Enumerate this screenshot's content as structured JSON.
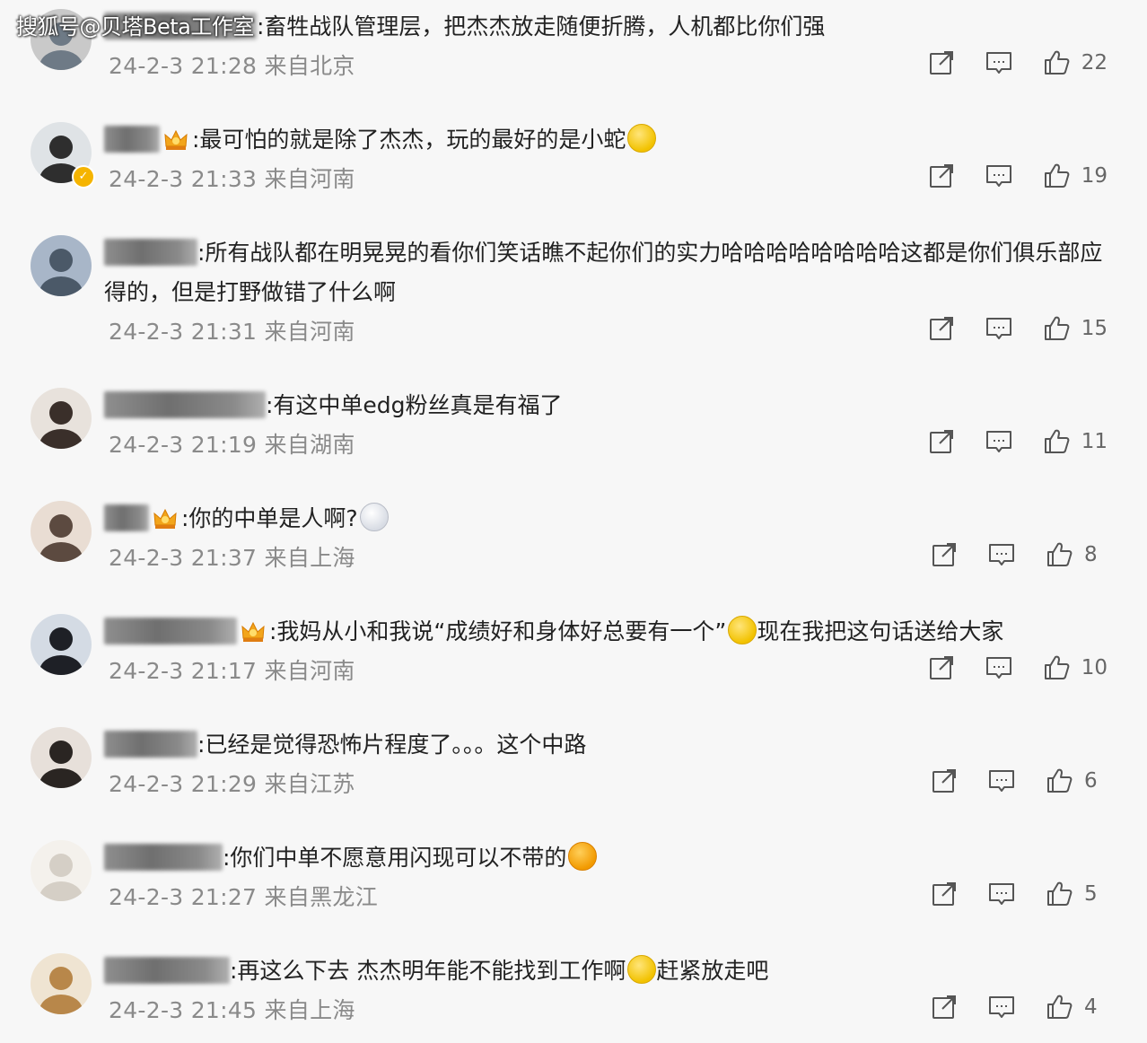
{
  "watermark": "搜狐号@贝塔Beta工作室",
  "comments": [
    {
      "text": ":畜牲战队管理层，把杰杰放走随便折腾，人机都比你们强",
      "crown": false,
      "emoji": "",
      "text2": "",
      "time": "24-2-3 21:28",
      "location": "来自北京",
      "likes": "22"
    },
    {
      "text": ":最可怕的就是除了杰杰，玩的最好的是小蛇",
      "crown": true,
      "emoji": "smile",
      "text2": "",
      "time": "24-2-3 21:33",
      "location": "来自河南",
      "likes": "19"
    },
    {
      "text": ":所有战队都在明晃晃的看你们笑话瞧不起你们的实力哈哈哈哈哈哈哈哈这都是你们俱乐部应得的，但是打野做错了什么啊",
      "crown": false,
      "emoji": "",
      "text2": "",
      "time": "24-2-3 21:31",
      "location": "来自河南",
      "likes": "15"
    },
    {
      "text": ":有这中单edg粉丝真是有福了",
      "crown": false,
      "emoji": "",
      "text2": "",
      "time": "24-2-3 21:19",
      "location": "来自湖南",
      "likes": "11"
    },
    {
      "text": ":你的中单是人啊?",
      "crown": true,
      "emoji": "egg",
      "text2": "",
      "time": "24-2-3 21:37",
      "location": "来自上海",
      "likes": "8"
    },
    {
      "text": ":我妈从小和我说“成绩好和身体好总要有一个”",
      "crown": true,
      "emoji": "cry",
      "text2": "现在我把这句话送给大家",
      "time": "24-2-3 21:17",
      "location": "来自河南",
      "likes": "10"
    },
    {
      "text": ":已经是觉得恐怖片程度了。。。这个中路",
      "crown": false,
      "emoji": "",
      "text2": "",
      "time": "24-2-3 21:29",
      "location": "来自江苏",
      "likes": "6"
    },
    {
      "text": ":你们中单不愿意用闪现可以不带的",
      "crown": false,
      "emoji": "grin",
      "text2": "",
      "time": "24-2-3 21:27",
      "location": "来自黑龙江",
      "likes": "5"
    },
    {
      "text": ":再这么下去 杰杰明年能不能找到工作啊",
      "crown": false,
      "emoji": "cry",
      "text2": "赶紧放走吧",
      "time": "24-2-3 21:45",
      "location": "来自上海",
      "likes": "4"
    }
  ]
}
